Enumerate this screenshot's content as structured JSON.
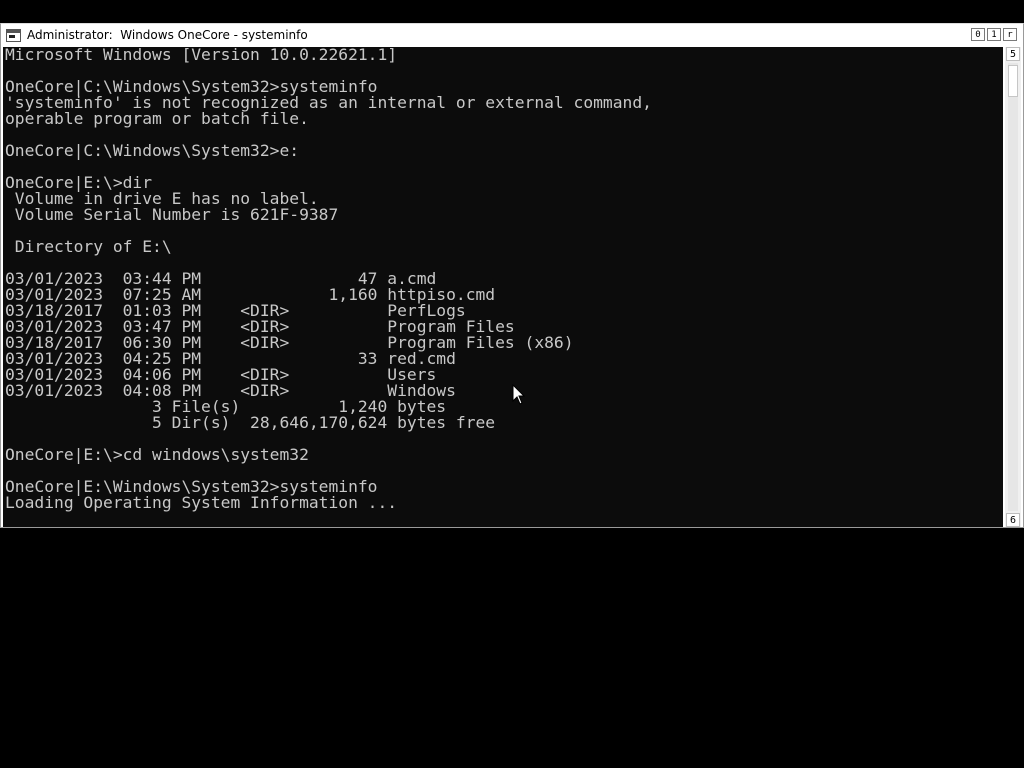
{
  "window": {
    "title": "Administrator:  Windows OneCore - systeminfo",
    "controls": {
      "minimize": "0",
      "maximize": "1",
      "close": "r"
    }
  },
  "console": {
    "lines": [
      "Microsoft Windows [Version 10.0.22621.1]",
      "",
      "OneCore|C:\\Windows\\System32>systeminfo",
      "'systeminfo' is not recognized as an internal or external command,",
      "operable program or batch file.",
      "",
      "OneCore|C:\\Windows\\System32>e:",
      "",
      "OneCore|E:\\>dir",
      " Volume in drive E has no label.",
      " Volume Serial Number is 621F-9387",
      "",
      " Directory of E:\\",
      "",
      "03/01/2023  03:44 PM                47 a.cmd",
      "03/01/2023  07:25 AM             1,160 httpiso.cmd",
      "03/18/2017  01:03 PM    <DIR>          PerfLogs",
      "03/01/2023  03:47 PM    <DIR>          Program Files",
      "03/18/2017  06:30 PM    <DIR>          Program Files (x86)",
      "03/01/2023  04:25 PM                33 red.cmd",
      "03/01/2023  04:06 PM    <DIR>          Users",
      "03/01/2023  04:08 PM    <DIR>          Windows",
      "               3 File(s)          1,240 bytes",
      "               5 Dir(s)  28,646,170,624 bytes free",
      "",
      "OneCore|E:\\>cd windows\\system32",
      "",
      "OneCore|E:\\Windows\\System32>systeminfo",
      "Loading Operating System Information ..."
    ]
  },
  "scrollbar": {
    "up_glyph": "5",
    "down_glyph": "6"
  },
  "colors": {
    "console_bg": "#0c0c0c",
    "console_fg": "#c8c8c8",
    "desktop_bg": "#000000"
  }
}
